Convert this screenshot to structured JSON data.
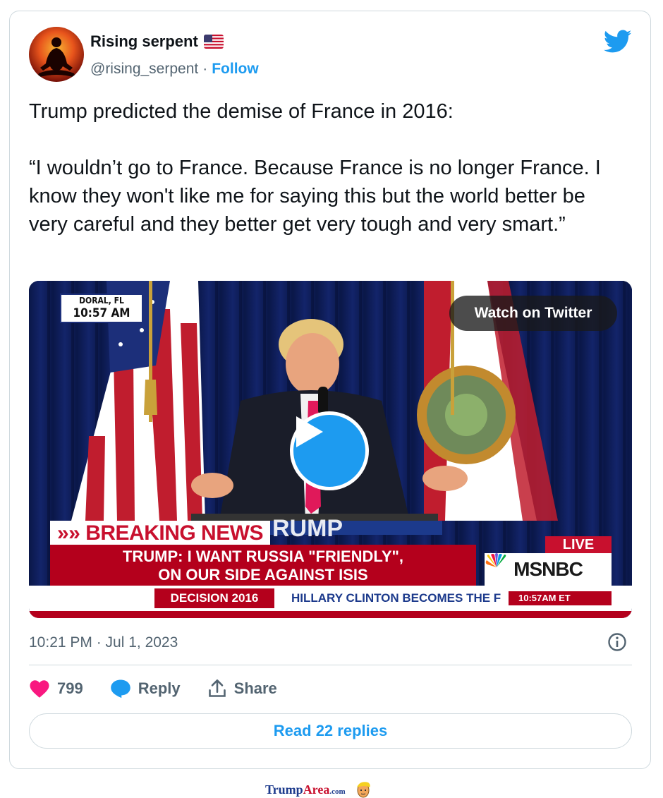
{
  "author": {
    "name": "Rising serpent",
    "flag": "us-flag-icon",
    "handle": "@rising_serpent",
    "separator": "·",
    "follow_label": "Follow"
  },
  "tweet": {
    "text": "Trump predicted the demise of France in 2016:\n\n“I wouldn’t go to France. Because France is no longer France. I know they won't like me for saying this but the world better be very careful and they better get very tough and very smart.”",
    "timestamp": "10:21 PM · Jul 1, 2023"
  },
  "media": {
    "watch_label": "Watch on Twitter",
    "location_city": "DORAL, FL",
    "location_time": "10:57 AM",
    "breaking_label": "»» BREAKING NEWS",
    "headline": "TRUMP: I WANT RUSSIA \"FRIENDLY\",\nON OUR SIDE AGAINST ISIS",
    "podium_text": "RUMP",
    "live_label": "LIVE",
    "network": "MSNBC",
    "ticker_section": "DECISION 2016",
    "ticker_text": "HILLARY CLINTON BECOMES THE F",
    "ticker_time": "10:57AM ET"
  },
  "actions": {
    "like_count": "799",
    "reply_label": "Reply",
    "share_label": "Share"
  },
  "read_replies_label": "Read 22 replies",
  "watermark": {
    "brand_part1": "Trump",
    "brand_part2": "Area",
    "brand_suffix": ".com"
  },
  "colors": {
    "accent": "#1d9bf0",
    "like": "#f91880",
    "secondary_text": "#536471",
    "border": "#cfd9de"
  }
}
